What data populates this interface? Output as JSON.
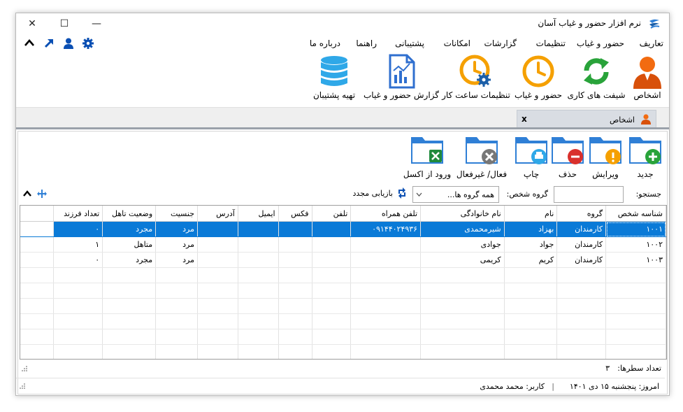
{
  "window": {
    "title": "نرم افزار حضور و غیاب آسان",
    "controls": {
      "close": "✕",
      "maximize": "☐",
      "minimize": "—"
    }
  },
  "menu": {
    "items": [
      "تعاریف",
      "حضور و غیاب",
      "تنظیمات",
      "گزارشات",
      "امکانات",
      "پشتیبانی",
      "راهنما",
      "درباره ما"
    ]
  },
  "ribbon": {
    "items": [
      {
        "label": "اشخاص",
        "icon": "person-icon"
      },
      {
        "label": "شیفت های کاری",
        "icon": "refresh-icon"
      },
      {
        "label": "حضور و غیاب",
        "icon": "clock-icon"
      },
      {
        "label": "تنظیمات ساعت کار",
        "icon": "clock-gear-icon"
      },
      {
        "label": "گزارش حضور و غیاب",
        "icon": "report-chart-icon"
      },
      {
        "label": "تهیه پشتیبان",
        "icon": "database-icon"
      }
    ]
  },
  "tab": {
    "label": "اشخاص",
    "close": "x"
  },
  "toolbar": {
    "items": [
      "جدید",
      "ویرایش",
      "حذف",
      "چاپ",
      "فعال/ غیرفعال",
      "ورود از اکسل"
    ]
  },
  "search": {
    "label": "جستجو:",
    "value": "",
    "group_label": "گروه شخص:",
    "group_value": "همه گروه ها...",
    "refresh_label": "بازیابی مجدد"
  },
  "table": {
    "columns": [
      "شناسه شخص",
      "گروه",
      "نام",
      "نام خانوادگی",
      "تلفن همراه",
      "تلفن",
      "فکس",
      "ایمیل",
      "آدرس",
      "جنسیت",
      "وضعیت تاهل",
      "تعداد فرزند"
    ],
    "rows": [
      [
        "۱۰۰۱",
        "کارمندان",
        "بهزاد",
        "شیرمحمدی",
        "۰۹۱۴۴۰۲۴۹۳۶",
        "",
        "",
        "",
        "",
        "مرد",
        "مجرد",
        "۰"
      ],
      [
        "۱۰۰۲",
        "کارمندان",
        "جواد",
        "جوادی",
        "",
        "",
        "",
        "",
        "",
        "مرد",
        "متاهل",
        "۱"
      ],
      [
        "۱۰۰۳",
        "کارمندان",
        "کریم",
        "کریمی",
        "",
        "",
        "",
        "",
        "",
        "مرد",
        "مجرد",
        "۰"
      ]
    ],
    "selected_row": 0
  },
  "footer": {
    "row_count_label": "تعداد سطرها:",
    "row_count": "۳"
  },
  "status": {
    "today": "امروز: پنجشنبه ۱۵ دی ۱۴۰۱",
    "separator": "|",
    "user": "کاربر: محمد محمدی"
  },
  "colors": {
    "accent": "#0a7ad7",
    "folder": "#2f7fd6",
    "orange": "#f5a000",
    "green": "#29a33a",
    "red": "#d9302c"
  }
}
